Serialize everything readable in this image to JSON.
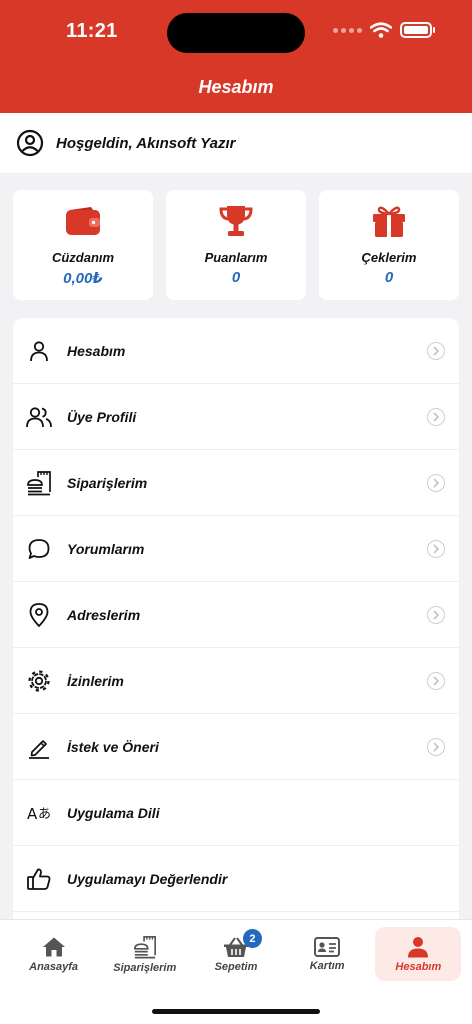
{
  "status_bar": {
    "time": "11:21"
  },
  "header": {
    "title": "Hesabım"
  },
  "welcome": {
    "text": "Hoşgeldin, Akınsoft Yazır",
    "icon": "user-circle-icon"
  },
  "cards": [
    {
      "label": "Cüzdanım",
      "value": "0,00₺",
      "icon": "wallet-icon"
    },
    {
      "label": "Puanlarım",
      "value": "0",
      "icon": "trophy-icon"
    },
    {
      "label": "Çeklerim",
      "value": "0",
      "icon": "gift-icon"
    }
  ],
  "menu": [
    {
      "label": "Hesabım",
      "icon": "user-icon",
      "chevron": true
    },
    {
      "label": "Üye Profili",
      "icon": "users-icon",
      "chevron": true
    },
    {
      "label": "Siparişlerim",
      "icon": "orders-icon",
      "chevron": true
    },
    {
      "label": "Yorumlarım",
      "icon": "comment-icon",
      "chevron": true
    },
    {
      "label": "Adreslerim",
      "icon": "location-pin-icon",
      "chevron": true
    },
    {
      "label": "İzinlerim",
      "icon": "gear-icon",
      "chevron": true
    },
    {
      "label": "İstek ve Öneri",
      "icon": "pencil-icon",
      "chevron": true
    },
    {
      "label": "Uygulama Dili",
      "icon": "language-icon",
      "chevron": false
    },
    {
      "label": "Uygulamayı Değerlendir",
      "icon": "thumbs-up-icon",
      "chevron": false
    }
  ],
  "tabbar": {
    "tabs": [
      {
        "label": "Anasayfa",
        "icon": "home-icon"
      },
      {
        "label": "Siparişlerim",
        "icon": "orders-icon"
      },
      {
        "label": "Sepetim",
        "icon": "basket-icon",
        "badge": "2"
      },
      {
        "label": "Kartım",
        "icon": "id-card-icon"
      },
      {
        "label": "Hesabım",
        "icon": "user-icon",
        "active": true
      }
    ]
  },
  "colors": {
    "brand": "#d73828",
    "value_blue": "#2569bd",
    "active_tab_bg": "#fde9e6"
  }
}
